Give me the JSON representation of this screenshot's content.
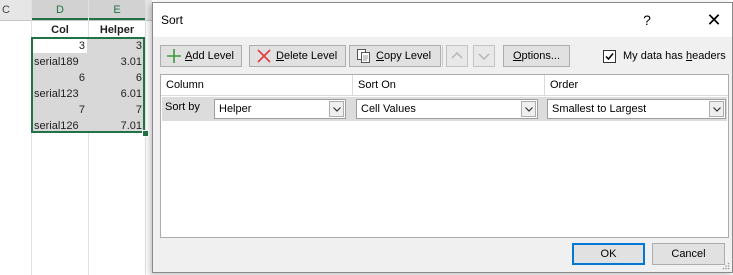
{
  "spreadsheet": {
    "column_headers": [
      "C",
      "D",
      "E"
    ],
    "header_row": {
      "col": "Col",
      "helper": "Helper"
    },
    "rows": [
      {
        "col": "3",
        "helper": "3"
      },
      {
        "col": "serial189",
        "helper": "3.01"
      },
      {
        "col": "6",
        "helper": "6"
      },
      {
        "col": "serial123",
        "helper": "6.01"
      },
      {
        "col": "7",
        "helper": "7"
      },
      {
        "col": "serial126",
        "helper": "7.01"
      }
    ],
    "accent_color": "#217346"
  },
  "dialog": {
    "title": "Sort",
    "help_glyph": "?",
    "close_glyph": "✕",
    "toolbar": {
      "add_level": "Add Level",
      "delete_level": "Delete Level",
      "copy_level": "Copy Level",
      "move_up_icon": "arrow-up",
      "move_down_icon": "arrow-down",
      "options": "Options..."
    },
    "has_headers": {
      "label": "My data has headers",
      "checked": true
    },
    "columns": {
      "column": "Column",
      "sort_on": "Sort On",
      "order": "Order"
    },
    "level": {
      "row_label": "Sort by",
      "column": "Helper",
      "sort_on": "Cell Values",
      "order": "Smallest to Largest"
    },
    "buttons": {
      "ok": "OK",
      "cancel": "Cancel"
    },
    "accent_color": "#0078d7"
  }
}
